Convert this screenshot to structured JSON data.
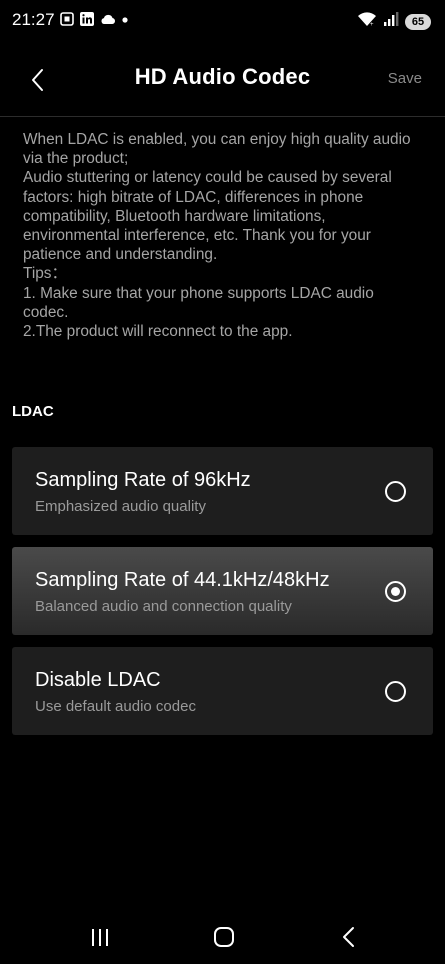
{
  "status_bar": {
    "time": "21:27",
    "battery": "65",
    "icons_left": [
      "screenshot-icon",
      "linkedin-icon",
      "cloud-icon",
      "dot-icon"
    ],
    "icons_right": [
      "wifi-icon",
      "signal-icon",
      "battery-icon"
    ]
  },
  "header": {
    "title": "HD Audio Codec",
    "save_label": "Save"
  },
  "description": {
    "lines": [
      "When LDAC is enabled, you can enjoy high quality audio via the product;",
      "Audio stuttering or latency could be caused by several factors: high bitrate of LDAC, differences in phone compatibility, Bluetooth hardware limitations, environmental interference, etc. Thank you for your patience and understanding.",
      "Tips：",
      "1. Make sure that your phone supports LDAC audio codec.",
      "2.The product will reconnect to the app."
    ]
  },
  "section_label": "LDAC",
  "options": [
    {
      "title": "Sampling Rate of 96kHz",
      "subtitle": "Emphasized audio quality",
      "selected": false
    },
    {
      "title": "Sampling Rate of 44.1kHz/48kHz",
      "subtitle": "Balanced audio and connection quality",
      "selected": true
    },
    {
      "title": "Disable LDAC",
      "subtitle": "Use default audio codec",
      "selected": false
    }
  ],
  "nav_bar": {
    "buttons": [
      "recents-icon",
      "home-icon",
      "back-icon"
    ]
  }
}
